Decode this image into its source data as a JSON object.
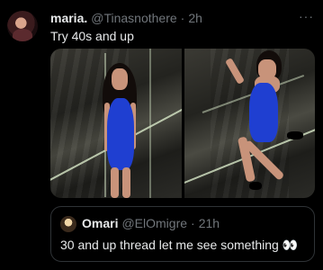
{
  "post": {
    "display_name": "maria.",
    "handle": "@Tinasnothere",
    "separator": "·",
    "time": "2h",
    "more_glyph": "···",
    "text": "Try 40s and up"
  },
  "quoted": {
    "display_name": "Omari",
    "handle": "@ElOmigre",
    "separator": "·",
    "time": "21h",
    "text": "30 and up thread let me see something 👀"
  },
  "colors": {
    "background": "#000000",
    "text_primary": "#e7e9ea",
    "text_secondary": "#71767b",
    "border": "#2f3336",
    "dress": "#1f3fd1"
  }
}
